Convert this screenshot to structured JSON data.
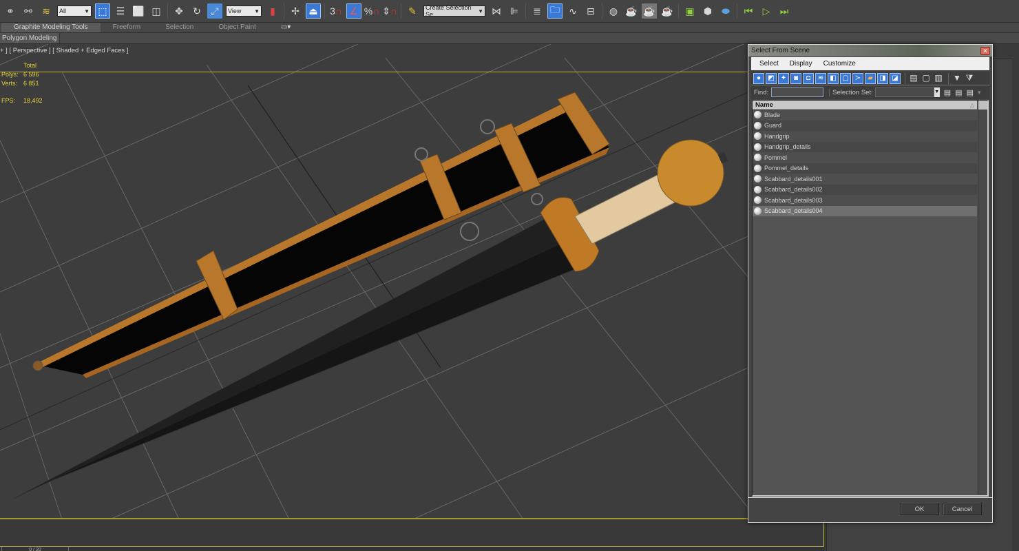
{
  "toolbar": {
    "filter_select": "All",
    "ref_coord_select": "View",
    "named_selection_select": "Create Selection Se",
    "snap_angle_label": "3",
    "icons": [
      "link-icon",
      "unlink-icon",
      "bind-space-warp-icon",
      "select-object-icon",
      "select-by-name-icon",
      "rect-selection-icon",
      "window-crossing-icon",
      "move-icon",
      "rotate-icon",
      "scale-icon",
      "select-manipulate-icon",
      "pivot-icon",
      "keyboard-shortcut-icon",
      "snap-toggle-icon",
      "angle-snap-icon",
      "percent-snap-icon",
      "spinner-snap-icon",
      "edit-named-selection-icon",
      "mirror-icon",
      "align-icon",
      "layer-manager-icon",
      "scene-explorer-icon",
      "curve-editor-icon",
      "schematic-view-icon",
      "material-editor-icon",
      "render-setup-icon",
      "rendered-frame-icon",
      "render-icon",
      "keyframe-icon",
      "timeline-icon",
      "play-icon"
    ]
  },
  "ribbon": {
    "tabs": [
      "Graphite Modeling Tools",
      "Freeform",
      "Selection",
      "Object Paint"
    ],
    "active_tab": "Graphite Modeling Tools",
    "panel_label": "Polygon Modeling"
  },
  "viewport": {
    "label": "+ ] [ Perspective ] [ Shaded + Edged Faces ]",
    "stats": {
      "header": "Total",
      "polys_label": "Polys:",
      "polys_value": "6 596",
      "verts_label": "Verts:",
      "verts_value": "6 851",
      "fps_label": "FPS:",
      "fps_value": "18,492"
    }
  },
  "timeline": {
    "frame_label": "0 / 20"
  },
  "dialog": {
    "title": "Select From Scene",
    "menu": [
      "Select",
      "Display",
      "Customize"
    ],
    "find_label": "Find:",
    "find_value": "",
    "selection_set_label": "Selection Set:",
    "selection_set_value": "",
    "column_header": "Name",
    "items": [
      {
        "name": "Blade",
        "selected": false
      },
      {
        "name": "Guard",
        "selected": false
      },
      {
        "name": "Handgrip",
        "selected": false
      },
      {
        "name": "Handgrip_details",
        "selected": false
      },
      {
        "name": "Pommel",
        "selected": false
      },
      {
        "name": "Pommel_details",
        "selected": false
      },
      {
        "name": "Scabbard_details001",
        "selected": false
      },
      {
        "name": "Scabbard_details002",
        "selected": false
      },
      {
        "name": "Scabbard_details003",
        "selected": false
      },
      {
        "name": "Scabbard_details004",
        "selected": true
      }
    ],
    "ok_label": "OK",
    "cancel_label": "Cancel"
  },
  "colors": {
    "accent": "#3a7ad6",
    "viewport_border": "#c7b53a",
    "stats_text": "#e1d33f",
    "scabbard_bronze": "#b8772a",
    "pommel_orange": "#c98a2e",
    "grip_beige": "#e3c9a0"
  }
}
